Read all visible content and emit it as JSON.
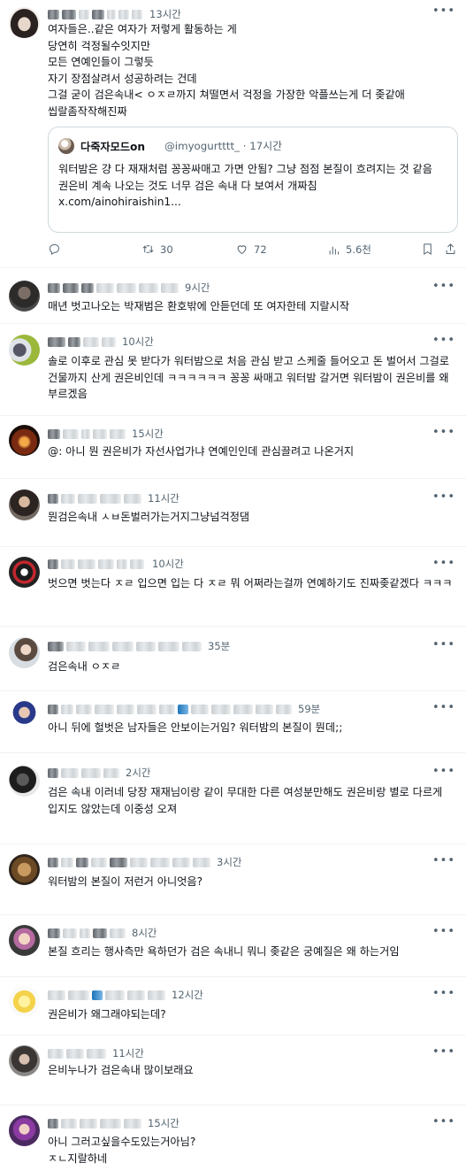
{
  "main_tweet": {
    "time": "13시간",
    "text": "여자들은..같은 여자가 저렇게 활동하는 게\n당연히 걱정될수잇지만\n모든 연예인들이 그렇듯\n자기 장점살려서 성공하려는 건데\n그걸 굳이 검은속내< ㅇㅈㄹ까지 쳐떨면서 걱정을 가장한 악플쓰는게 더 좆같애 씹랄좀작작해진짜",
    "quote": {
      "name": "다죽자모드on",
      "handle": "@imyogurtttt_ · 17시간",
      "text": "워터밤은 걍 다 재재처럼 꽁꽁싸매고 가면 안됨? 그냥 점점 본질이 흐려지는 것 같음\n권은비 계속 나오는 것도 너무 검은 속내 다 보여서 개짜침\nx.com/ainohiraishin1..."
    },
    "stats": {
      "retweets": "30",
      "likes": "72",
      "views": "5.6천"
    }
  },
  "replies": [
    {
      "time": "9시간",
      "text": "매년 벗고나오는 박재범은 환호밖에 안듣던데 또 여자한테 지랄시작"
    },
    {
      "time": "10시간",
      "text": "솔로 이후로 관심 못 받다가 워터밤으로 처음 관심 받고 스케줄 들어오고 돈 벌어서 그걸로 건물까지 산게 권은비인데 ㅋㅋㅋㅋㅋㅋ 꽁꽁 싸매고 워터밤 갈거면 워터밤이 권은비를 왜 부르겠음"
    },
    {
      "time": "15시간",
      "text": "@: 아니 뭔 권은비가 자선사업가냐 연예인인데 관심끌려고 나온거지"
    },
    {
      "time": "11시간",
      "text": "뭔검은속내 ㅅㅂ돈벌러가는거지그냥넘걱정댐"
    },
    {
      "time": "10시간",
      "text": "벗으면 벗는다 ㅈㄹ 입으면 입는 다 ㅈㄹ 뭐 어쩌라는걸까 연예하기도 진짜좆같겠다 ㅋㅋㅋ"
    },
    {
      "time": "35분",
      "text": "검은속내 ㅇㅈㄹ"
    },
    {
      "time": "59분",
      "text": "아니 뒤에 헐벗은 남자들은 안보이는거임? 워터밤의 본질이 뭔데;;"
    },
    {
      "time": "2시간",
      "text": "검은 속내 이러네 당장 재재님이랑 같이 무대한 다른 여성분만해도 권은비랑 별로 다르게 입지도 않았는데 이중성 오져"
    },
    {
      "time": "3시간",
      "text": "워터밤의 본질이 저런거 아니엇음?"
    },
    {
      "time": "8시간",
      "text": "본질 흐리는 행사측만 욕하던가 검은 속내니 뭐니 좆같은 궁예질은 왜 하는거임"
    },
    {
      "time": "12시간",
      "text": "권은비가 왜그래야되는데?"
    },
    {
      "time": "11시간",
      "text": "은비누나가 검은속내 많이보래요"
    },
    {
      "time": "15시간",
      "text": "아니 그러고싶을수도있는거아님?\nㅈㄴ지랄하네"
    }
  ],
  "icons": {
    "more": "more-dots-icon",
    "reply": "reply-icon",
    "retweet": "retweet-icon",
    "like": "heart-icon",
    "views": "views-icon",
    "bookmark": "bookmark-icon",
    "share": "share-icon"
  },
  "colors": {
    "text": "#0f1419",
    "secondary": "#536471",
    "divider": "#eff3f4"
  }
}
